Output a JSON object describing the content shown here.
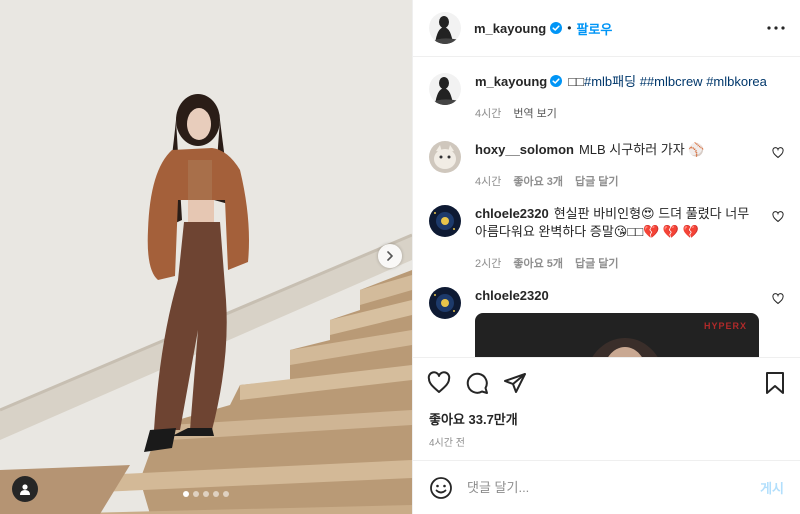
{
  "header": {
    "username": "m_kayoung",
    "separator": "•",
    "follow_label": "팔로우"
  },
  "caption": {
    "username": "m_kayoung",
    "prefix": "□□",
    "tags": [
      "#mlb패딩",
      "##mlbcrew",
      "#mlbkorea"
    ],
    "time": "4시간",
    "translate": "번역 보기"
  },
  "comments": [
    {
      "username": "hoxy__solomon",
      "text": "MLB 시구하러 가자 ⚾",
      "time": "4시간",
      "likes": "좋아요 3개",
      "reply": "답글 달기"
    },
    {
      "username": "chloele2320",
      "text": "현실판 바비인형😍 드뎌 풀렸다 너무 아름다워요 완벽하다 증말😘□□💔 💔 💔",
      "time": "2시간",
      "likes": "좋아요 5개",
      "reply": "답글 달기"
    },
    {
      "username": "chloele2320",
      "embed_brand": "HYPERX"
    }
  ],
  "post": {
    "likes": "좋아요 33.7만개",
    "time": "4시간 전"
  },
  "comment_box": {
    "placeholder": "댓글 달기...",
    "post_label": "게시"
  },
  "carousel": {
    "count": 5,
    "active": 0
  },
  "icons": {
    "verified": "verified-badge-icon",
    "more": "more-options-icon",
    "like": "heart-icon",
    "comment": "comment-bubble-icon",
    "share": "paper-plane-icon",
    "save": "bookmark-icon",
    "emoji": "emoji-smile-icon",
    "next": "chevron-right-icon",
    "tag": "user-tag-icon"
  },
  "colors": {
    "accent": "#0095f6",
    "post_disabled": "#b2dffc",
    "meta": "#8e8e8e",
    "hashtag": "#00376b"
  }
}
